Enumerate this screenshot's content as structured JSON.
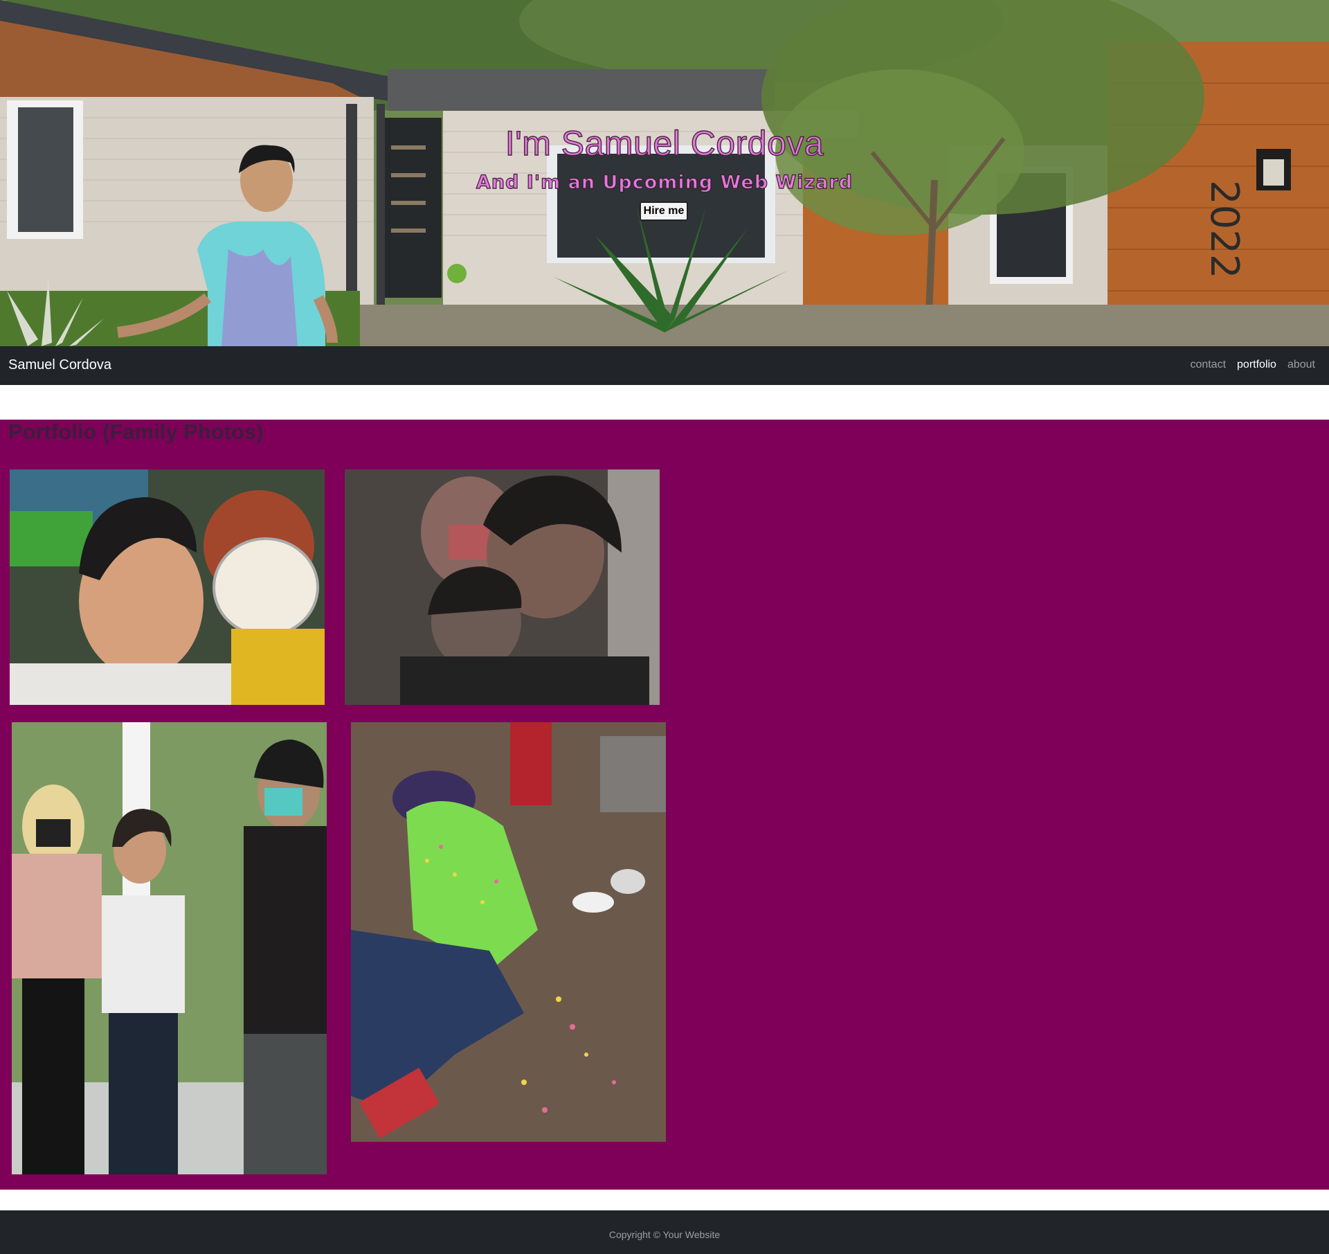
{
  "hero": {
    "title": "I'm Samuel Cordova",
    "subtitle": "And I'm an Upcoming Web Wizard",
    "hire_button": "Hire me"
  },
  "navbar": {
    "brand": "Samuel Cordova",
    "links": [
      {
        "label": "contact",
        "active": false
      },
      {
        "label": "portfolio",
        "active": true
      },
      {
        "label": "about",
        "active": false
      }
    ]
  },
  "portfolio": {
    "heading": "Portfolio (Family Photos)",
    "background": "#7f0058"
  },
  "footer": {
    "copyright": "Copyright © Your Website"
  },
  "colors": {
    "navbar": "#212529",
    "accent_text": "#e07bd9"
  }
}
